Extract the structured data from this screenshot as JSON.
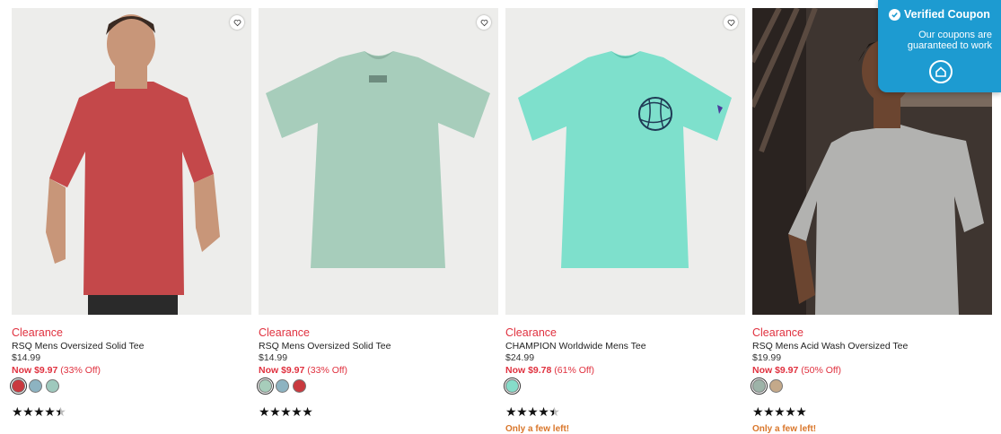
{
  "products": [
    {
      "badge": "Clearance",
      "name": "RSQ Mens Oversized Solid Tee",
      "original_price": "$14.99",
      "sale_price": "Now $9.97",
      "discount": "(33% Off)",
      "swatches": [
        "#c9393e",
        "#8db3c1",
        "#9fc9bd"
      ],
      "selected_swatch": 0,
      "rating": 4.5,
      "stock_note": ""
    },
    {
      "badge": "Clearance",
      "name": "RSQ Mens Oversized Solid Tee",
      "original_price": "$14.99",
      "sale_price": "Now $9.97",
      "discount": "(33% Off)",
      "swatches": [
        "#a7cdbb",
        "#8db3c1",
        "#c9393e"
      ],
      "selected_swatch": 0,
      "rating": 5,
      "stock_note": ""
    },
    {
      "badge": "Clearance",
      "name": "CHAMPION Worldwide Mens Tee",
      "original_price": "$24.99",
      "sale_price": "Now $9.78",
      "discount": "(61% Off)",
      "swatches": [
        "#86dcc9"
      ],
      "selected_swatch": 0,
      "rating": 4.5,
      "stock_note": "Only a few left!"
    },
    {
      "badge": "Clearance",
      "name": "RSQ Mens Acid Wash Oversized Tee",
      "original_price": "$19.99",
      "sale_price": "Now $9.97",
      "discount": "(50% Off)",
      "swatches": [
        "#9db3a8",
        "#c4a98a"
      ],
      "selected_swatch": 0,
      "rating": 5,
      "stock_note": "Only a few left!"
    }
  ],
  "coupon_widget": {
    "title": "Verified Coupon",
    "message": "Our coupons are guaranteed to work",
    "color": "#1d9bd1"
  },
  "icons": {
    "favorite": "heart-outline-icon",
    "verified": "checkmark-icon",
    "coupon_logo": "house-icon"
  }
}
